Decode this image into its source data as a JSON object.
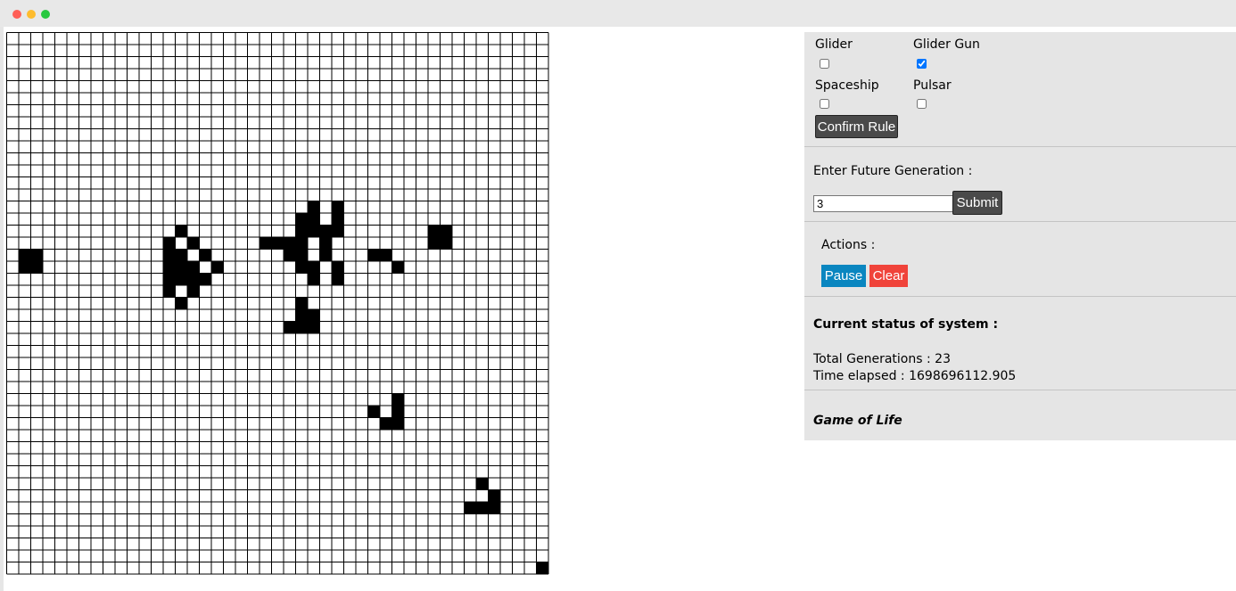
{
  "window": {
    "controls": [
      "close",
      "minimize",
      "maximize"
    ]
  },
  "grid": {
    "rows": 45,
    "cols": 45,
    "line_color": "#000000",
    "alive_color": "#000000",
    "dead_color": "#ffffff",
    "alive_cells": [
      [
        14,
        25
      ],
      [
        14,
        27
      ],
      [
        15,
        24
      ],
      [
        15,
        25
      ],
      [
        15,
        27
      ],
      [
        16,
        14
      ],
      [
        16,
        24
      ],
      [
        16,
        25
      ],
      [
        16,
        26
      ],
      [
        16,
        27
      ],
      [
        16,
        35
      ],
      [
        16,
        36
      ],
      [
        17,
        13
      ],
      [
        17,
        15
      ],
      [
        17,
        21
      ],
      [
        17,
        22
      ],
      [
        17,
        23
      ],
      [
        17,
        24
      ],
      [
        17,
        26
      ],
      [
        17,
        35
      ],
      [
        17,
        36
      ],
      [
        18,
        1
      ],
      [
        18,
        2
      ],
      [
        18,
        13
      ],
      [
        18,
        14
      ],
      [
        18,
        16
      ],
      [
        18,
        23
      ],
      [
        18,
        24
      ],
      [
        18,
        26
      ],
      [
        18,
        30
      ],
      [
        18,
        31
      ],
      [
        19,
        1
      ],
      [
        19,
        2
      ],
      [
        19,
        13
      ],
      [
        19,
        14
      ],
      [
        19,
        15
      ],
      [
        19,
        17
      ],
      [
        19,
        24
      ],
      [
        19,
        25
      ],
      [
        19,
        27
      ],
      [
        19,
        32
      ],
      [
        20,
        13
      ],
      [
        20,
        14
      ],
      [
        20,
        15
      ],
      [
        20,
        16
      ],
      [
        20,
        25
      ],
      [
        20,
        27
      ],
      [
        21,
        13
      ],
      [
        21,
        15
      ],
      [
        22,
        14
      ],
      [
        22,
        24
      ],
      [
        23,
        24
      ],
      [
        23,
        25
      ],
      [
        24,
        23
      ],
      [
        24,
        24
      ],
      [
        24,
        25
      ],
      [
        30,
        32
      ],
      [
        31,
        30
      ],
      [
        31,
        32
      ],
      [
        32,
        31
      ],
      [
        32,
        32
      ],
      [
        37,
        39
      ],
      [
        38,
        40
      ],
      [
        39,
        38
      ],
      [
        39,
        39
      ],
      [
        39,
        40
      ],
      [
        44,
        44
      ]
    ]
  },
  "rules": {
    "glider": {
      "label": "Glider",
      "checked": false
    },
    "glider_gun": {
      "label": "Glider Gun",
      "checked": true
    },
    "spaceship": {
      "label": "Spaceship",
      "checked": false
    },
    "pulsar": {
      "label": "Pulsar",
      "checked": false
    },
    "confirm_label": "Confirm Rule"
  },
  "generation": {
    "prompt": "Enter Future Generation :",
    "value": "3",
    "submit_label": "Submit"
  },
  "actions": {
    "heading": "Actions :",
    "pause_label": "Pause",
    "clear_label": "Clear"
  },
  "status": {
    "heading": "Current status of system :",
    "total_generations": "Total Generations : 23",
    "time_elapsed": "Time elapsed : 1698696112.905"
  },
  "footer_title": "Game of Life",
  "colors": {
    "panel_bg": "#e5e5e5",
    "button_dark": "#4a4a4a",
    "pause_blue": "#0a86c0",
    "clear_red": "#f0433a"
  }
}
